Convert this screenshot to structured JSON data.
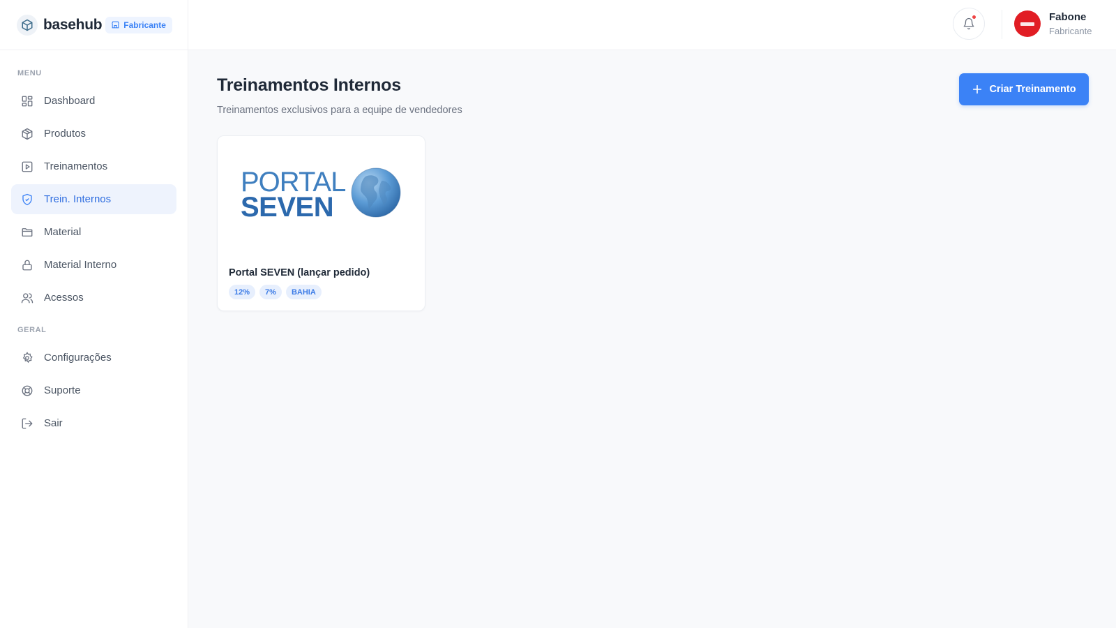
{
  "brand": {
    "name": "basehub",
    "badge": "Fabricante"
  },
  "sidebar": {
    "menu_label": "MENU",
    "geral_label": "GERAL",
    "menu_items": [
      {
        "label": "Dashboard",
        "icon": "grid-icon",
        "active": false
      },
      {
        "label": "Produtos",
        "icon": "box-icon",
        "active": false
      },
      {
        "label": "Treinamentos",
        "icon": "play-square-icon",
        "active": false
      },
      {
        "label": "Trein. Internos",
        "icon": "shield-check-icon",
        "active": true
      },
      {
        "label": "Material",
        "icon": "folder-icon",
        "active": false
      },
      {
        "label": "Material Interno",
        "icon": "lock-icon",
        "active": false
      },
      {
        "label": "Acessos",
        "icon": "users-icon",
        "active": false
      }
    ],
    "geral_items": [
      {
        "label": "Configurações",
        "icon": "gear-icon"
      },
      {
        "label": "Suporte",
        "icon": "lifebuoy-icon"
      },
      {
        "label": "Sair",
        "icon": "logout-icon"
      }
    ]
  },
  "topbar": {
    "user_name": "Fabone",
    "user_role": "Fabricante",
    "notification_dot": true
  },
  "main": {
    "title": "Treinamentos Internos",
    "subtitle": "Treinamentos exclusivos para a equipe de vendedores",
    "create_button": "Criar Treinamento",
    "cards": [
      {
        "title": "Portal SEVEN (lançar pedido)",
        "logo_line1": "PORTAL",
        "logo_line2": "SEVEN",
        "tags": [
          "12%",
          "7%",
          "BAHIA"
        ]
      }
    ]
  },
  "colors": {
    "accent": "#3b82f6",
    "active_bg": "#eef3fd",
    "avatar": "#e11d24",
    "notification": "#ef4444"
  }
}
